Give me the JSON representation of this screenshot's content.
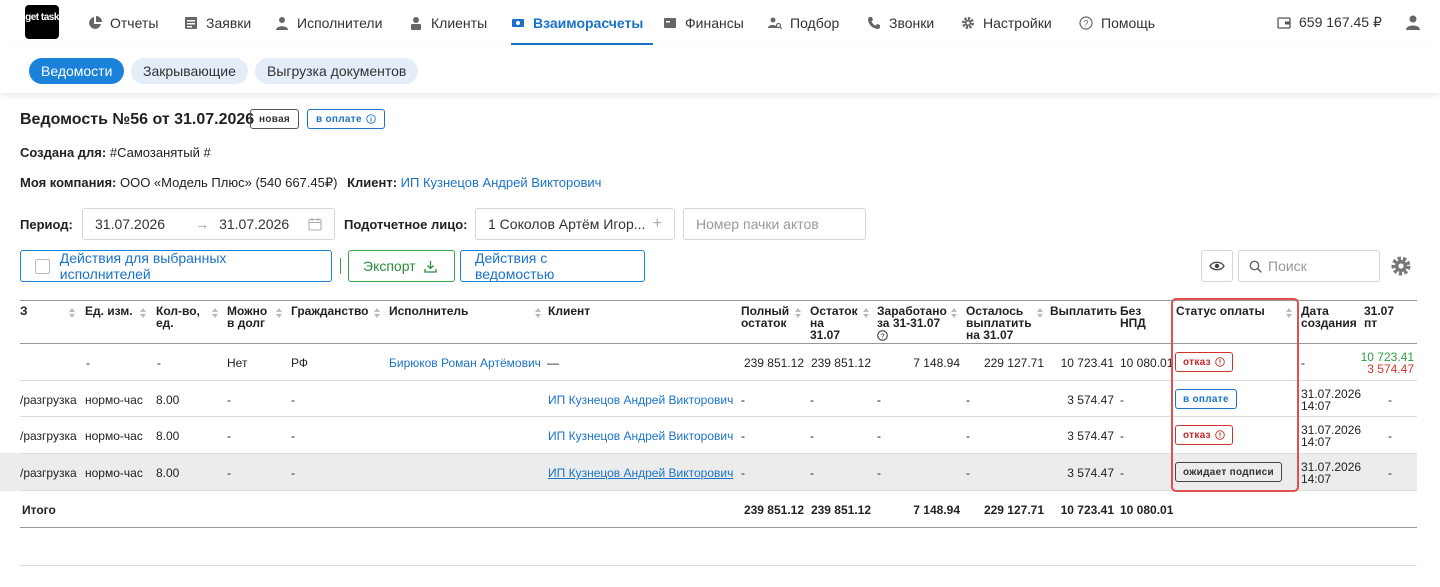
{
  "nav": {
    "logo_text": "get task",
    "items": [
      {
        "label": "Отчеты",
        "icon": "pie-chart-icon"
      },
      {
        "label": "Заявки",
        "icon": "list-icon"
      },
      {
        "label": "Исполнители",
        "icon": "person-icon"
      },
      {
        "label": "Клиенты",
        "icon": "client-icon"
      },
      {
        "label": "Взаиморасчеты",
        "icon": "exchange-icon",
        "active": true
      },
      {
        "label": "Финансы",
        "icon": "wallet-icon"
      },
      {
        "label": "Подбор",
        "icon": "search-people-icon"
      },
      {
        "label": "Звонки",
        "icon": "phone-icon"
      },
      {
        "label": "Настройки",
        "icon": "gear-icon"
      },
      {
        "label": "Помощь",
        "icon": "help-icon"
      }
    ],
    "balance": "659 167.45 ₽"
  },
  "subtabs": [
    "Ведомости",
    "Закрывающие",
    "Выгрузка документов"
  ],
  "header": {
    "title": "Ведомость №56 от 31.07.2026",
    "badge_new": "новая",
    "badge_pay": "в оплате",
    "created_for_label": "Создана для:",
    "created_for_value": "#Самозанятый #",
    "company_label": "Моя компания:",
    "company_value": "ООО «Модель Плюс» (540 667.45₽)",
    "client_label": "Клиент:",
    "client_value": "ИП Кузнецов Андрей Викторович"
  },
  "filters": {
    "period_label": "Период:",
    "date_from": "31.07.2026",
    "date_to": "31.07.2026",
    "person_label": "Подотчетное лицо:",
    "person_value": "1 Соколов Артём Игор...",
    "batch_placeholder": "Номер пачки актов"
  },
  "actions": {
    "selected_actions": "Действия для выбранных исполнителей",
    "export": "Экспорт",
    "sheet_actions": "Действия с ведомостью",
    "search_placeholder": "Поиск"
  },
  "table": {
    "headers": {
      "c0": "З",
      "unit": "Ед. изм.",
      "qty1": "Кол-во,",
      "qty2": "ед.",
      "debt1": "Можно",
      "debt2": "в долг",
      "citizenship": "Гражданство",
      "executor": "Исполнитель",
      "client": "Клиент",
      "full1": "Полный",
      "full2": "остаток",
      "rem1": "Остаток",
      "rem2": "на",
      "rem3": "31.07",
      "earn1": "Заработано",
      "earn2": "за 31-31.07",
      "left1": "Осталось",
      "left2": "выплатить",
      "left3": "на 31.07",
      "pay": "Выплатить",
      "npd1": "Без",
      "npd2": "НПД",
      "status": "Статус оплаты",
      "created1": "Дата",
      "created2": "создания",
      "last1": "31.07",
      "last2": "пт"
    },
    "rows": [
      {
        "c0": "",
        "unit": "-",
        "qty": "-",
        "debt": "Нет",
        "citizenship": "РФ",
        "executor": "Бирюков Роман Артёмович",
        "client": "—",
        "full": "239 851.12",
        "rem": "239 851.12",
        "earn": "7 148.94",
        "left": "229 127.71",
        "pay": "10 723.41",
        "npd": "10 080.01",
        "status": "отказ",
        "created_date": "-",
        "created_time": "",
        "last_a": "10 723.41",
        "last_b": "3 574.47"
      },
      {
        "c0": "/разгрузка",
        "unit": "нормо-час",
        "qty": "8.00",
        "debt": "-",
        "citizenship": "-",
        "executor": "",
        "client": "ИП Кузнецов Андрей Викторович",
        "full": "-",
        "rem": "-",
        "earn": "-",
        "left": "-",
        "pay": "3 574.47",
        "npd": "-",
        "status": "в оплате",
        "created_date": "31.07.2026",
        "created_time": "14:07",
        "last_a": "-",
        "last_b": ""
      },
      {
        "c0": "/разгрузка",
        "unit": "нормо-час",
        "qty": "8.00",
        "debt": "-",
        "citizenship": "-",
        "executor": "",
        "client": "ИП Кузнецов Андрей Викторович",
        "full": "-",
        "rem": "-",
        "earn": "-",
        "left": "-",
        "pay": "3 574.47",
        "npd": "-",
        "status": "отказ",
        "created_date": "31.07.2026",
        "created_time": "14:07",
        "last_a": "-",
        "last_b": ""
      },
      {
        "c0": "/разгрузка",
        "unit": "нормо-час",
        "qty": "8.00",
        "debt": "-",
        "citizenship": "-",
        "executor": "",
        "client": "ИП Кузнецов Андрей Викторович",
        "full": "-",
        "rem": "-",
        "earn": "-",
        "left": "-",
        "pay": "3 574.47",
        "npd": "-",
        "status": "ожидает подписи",
        "created_date": "31.07.2026",
        "created_time": "14:07",
        "last_a": "-",
        "last_b": ""
      }
    ],
    "total": {
      "label": "Итого",
      "full": "239 851.12",
      "rem": "239 851.12",
      "earn": "7 148.94",
      "left": "229 127.71",
      "pay": "10 723.41",
      "npd": "10 080.01"
    }
  },
  "colors": {
    "accent": "#1a73c8",
    "pill_active": "#1a82d9",
    "export_green": "#2e8b3a",
    "status_red": "#c62828",
    "highlight_box": "#e05050",
    "positive": "#2e9d3c",
    "negative": "#d0312d"
  }
}
